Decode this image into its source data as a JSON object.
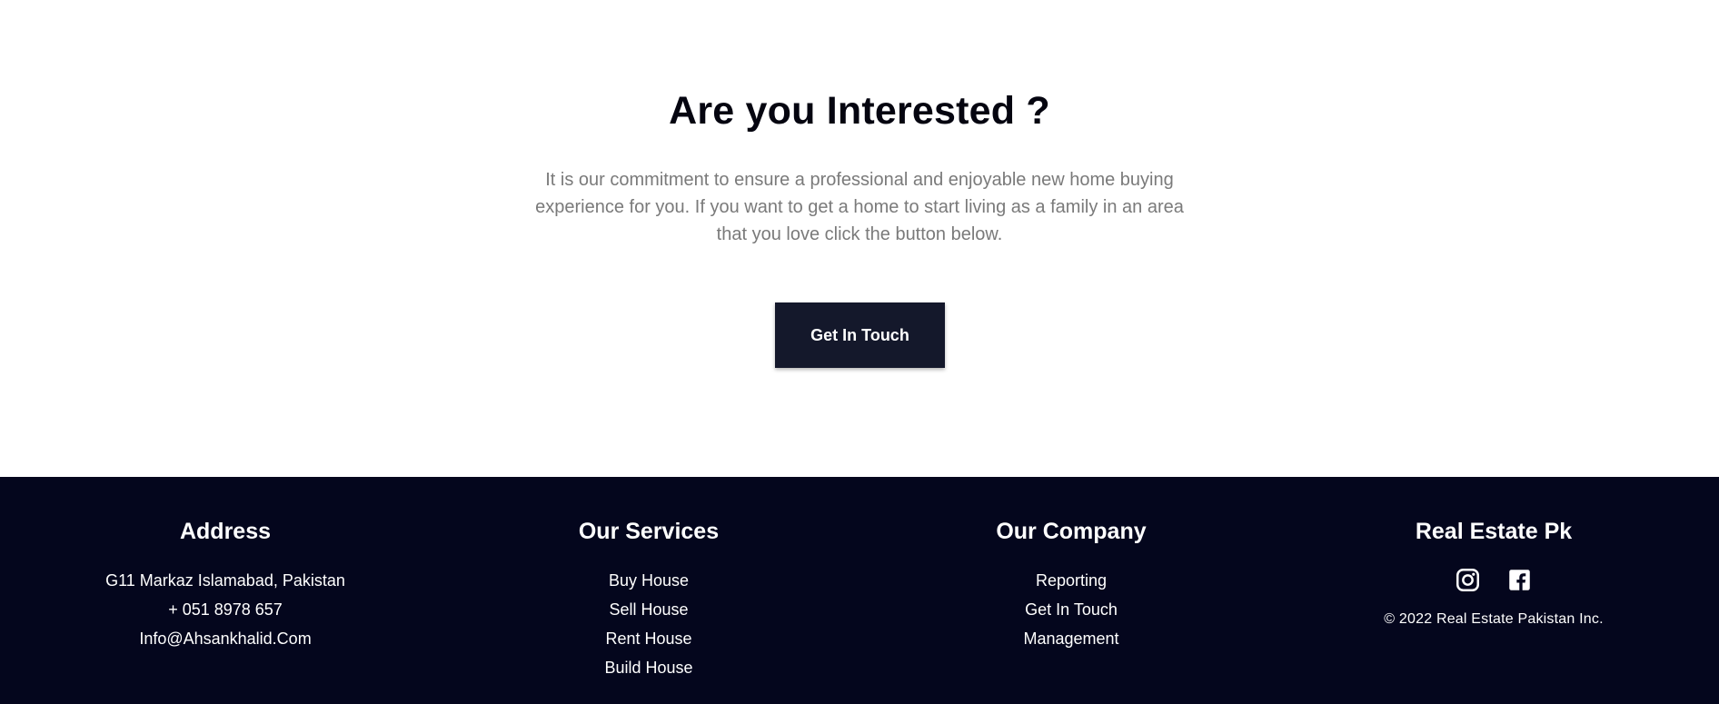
{
  "cta": {
    "title": "Are you Interested ?",
    "text": "It is our commitment to ensure a professional and enjoyable new home buying experience for you. If you want to get a home to start living as a family in an area that you love click the button below.",
    "button_label": "Get In Touch"
  },
  "footer": {
    "address": {
      "title": "Address",
      "lines": [
        "G11 Markaz Islamabad, Pakistan",
        "+ 051 8978 657",
        "Info@Ahsankhalid.Com"
      ]
    },
    "services": {
      "title": "Our Services",
      "items": [
        "Buy House",
        "Sell House",
        "Rent House",
        "Build House"
      ]
    },
    "company": {
      "title": "Our Company",
      "items": [
        "Reporting",
        "Get In Touch",
        "Management"
      ]
    },
    "brand": {
      "title": "Real Estate Pk",
      "icons": [
        "instagram-icon",
        "facebook-icon"
      ],
      "copyright": "© 2022 Real Estate Pakistan Inc."
    }
  },
  "colors": {
    "footer_bg": "#04061d",
    "button_bg": "#14182b",
    "body_text": "#7a7a7a"
  }
}
